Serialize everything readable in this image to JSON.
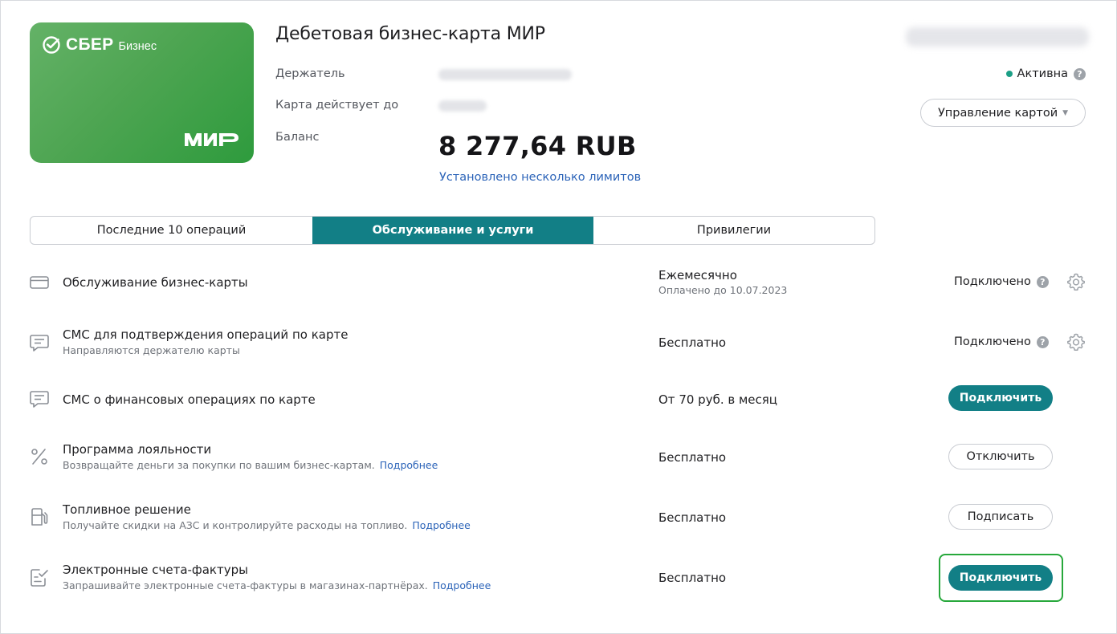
{
  "card": {
    "brand": "СБЕР",
    "brand_sub": "Бизнес",
    "payment_system": "МИР",
    "gradient_colors": [
      "#64b267",
      "#2e9b3d"
    ]
  },
  "header": {
    "title": "Дебетовая бизнес-карта МИР",
    "holder_label": "Держатель",
    "valid_label": "Карта действует до",
    "balance_label": "Баланс",
    "balance_value": "8 277,64 RUB",
    "limits_link": "Установлено несколько лимитов",
    "status": "Активна",
    "status_color": "#1c9f86",
    "manage_button": "Управление картой"
  },
  "tabs": [
    {
      "label": "Последние 10 операций",
      "active": false
    },
    {
      "label": "Обслуживание и услуги",
      "active": true
    },
    {
      "label": "Привилегии",
      "active": false
    }
  ],
  "accent_color": "#127f86",
  "services": [
    {
      "icon": "card-icon",
      "title": "Обслуживание бизнес-карты",
      "subtitle": "",
      "more": "",
      "price": "Ежемесячно",
      "price_sub": "Оплачено до 10.07.2023",
      "state": "Подключено",
      "action": ""
    },
    {
      "icon": "sms-icon",
      "title": "СМС для подтверждения операций по карте",
      "subtitle": "Направляются держателю карты",
      "more": "",
      "price": "Бесплатно",
      "price_sub": "",
      "state": "Подключено",
      "action": ""
    },
    {
      "icon": "sms-icon",
      "title": "СМС о финансовых операциях по карте",
      "subtitle": "",
      "more": "",
      "price": "От 70 руб. в месяц",
      "price_sub": "",
      "state": "",
      "action": "Подключить"
    },
    {
      "icon": "percent-icon",
      "title": "Программа лояльности",
      "subtitle": "Возвращайте деньги за покупки по вашим бизнес-картам.",
      "more": "Подробнее",
      "price": "Бесплатно",
      "price_sub": "",
      "state": "",
      "action": "Отключить"
    },
    {
      "icon": "fuel-icon",
      "title": "Топливное решение",
      "subtitle": "Получайте скидки на АЗС и контролируйте расходы на топливо.",
      "more": "Подробнее",
      "price": "Бесплатно",
      "price_sub": "",
      "state": "",
      "action": "Подписать"
    },
    {
      "icon": "invoice-icon",
      "title": "Электронные счета-фактуры",
      "subtitle": "Запрашивайте электронные счета-фактуры в магазинах-партнёрах.",
      "more": "Подробнее",
      "price": "Бесплатно",
      "price_sub": "",
      "state": "",
      "action": "Подключить"
    }
  ]
}
